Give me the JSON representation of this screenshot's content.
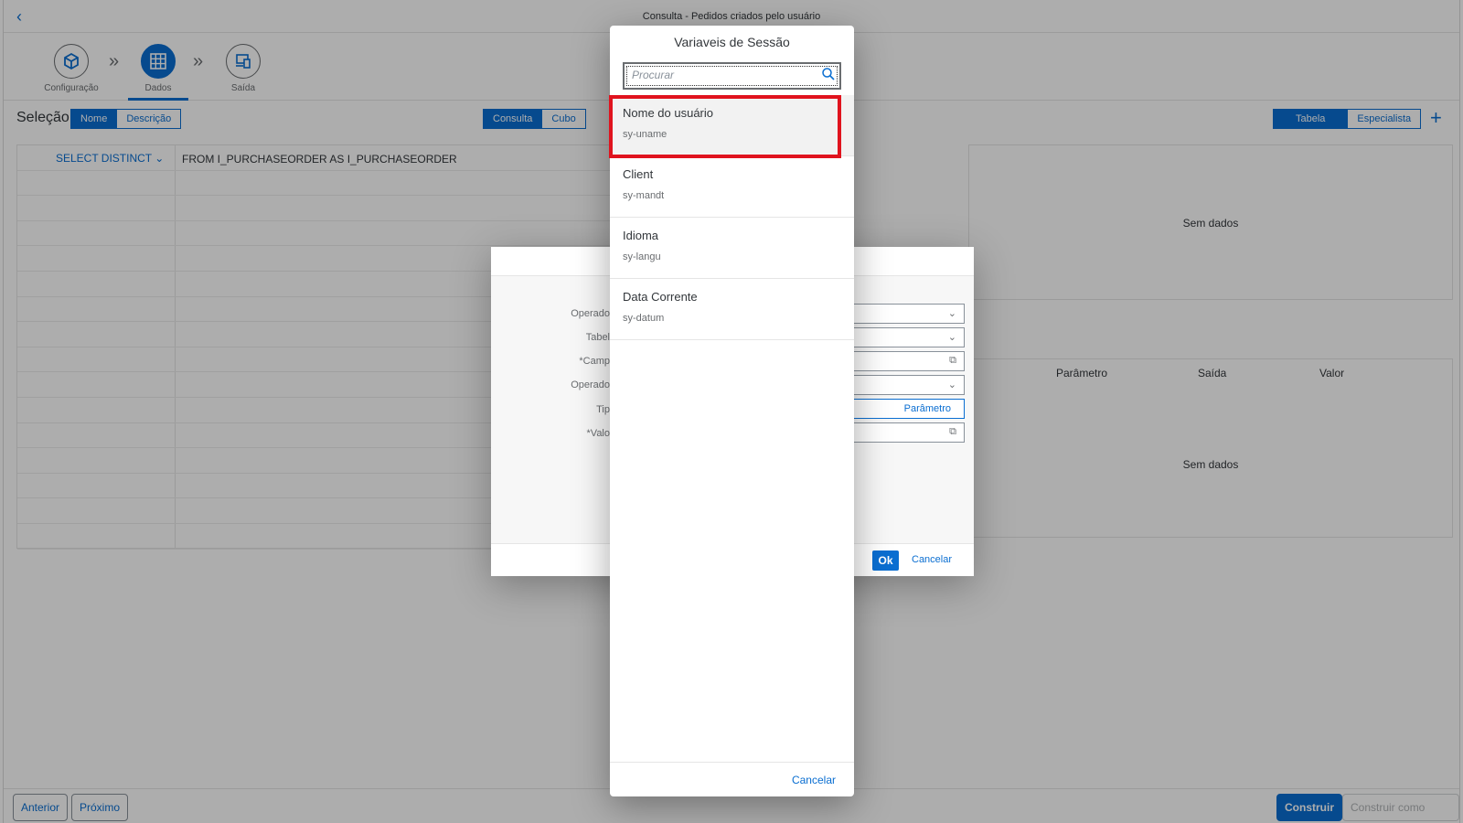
{
  "shell": {
    "title": "Consulta - Pedidos criados pelo usuário"
  },
  "steps": [
    {
      "label": "Configuração",
      "icon": "cube-icon"
    },
    {
      "label": "Dados",
      "icon": "grid-icon"
    },
    {
      "label": "Saída",
      "icon": "devices-icon"
    }
  ],
  "selection": {
    "label": "Seleção",
    "toggle": [
      "Nome",
      "Descrição"
    ],
    "mode": [
      "Consulta",
      "Cubo"
    ],
    "view": [
      "Tabela",
      "Especialista"
    ]
  },
  "query": {
    "select": "SELECT DISTINCT",
    "from": "FROM I_PURCHASEORDER AS I_PURCHASEORDER"
  },
  "right_panel": {
    "no_data_top": "Sem dados",
    "columns": [
      "Parâmetro",
      "Saída",
      "Valor"
    ],
    "no_data_bottom": "Sem dados"
  },
  "filter_dialog": {
    "labels": [
      "Operado",
      "Tabel",
      "*Camp",
      "Operado",
      "Tip",
      "*Valo"
    ],
    "tipo_button": "Parâmetro",
    "ok": "Ok",
    "cancel": "Cancelar"
  },
  "footer": {
    "prev": "Anterior",
    "next": "Próximo",
    "build": "Construir",
    "build_new": "Construir como novo"
  },
  "popup": {
    "title": "Variaveis de Sessão",
    "search_placeholder": "Procurar",
    "items": [
      {
        "title": "Nome do usuário",
        "desc": "sy-uname"
      },
      {
        "title": "Client",
        "desc": "sy-mandt"
      },
      {
        "title": "Idioma",
        "desc": "sy-langu"
      },
      {
        "title": "Data Corrente",
        "desc": "sy-datum"
      }
    ],
    "cancel": "Cancelar"
  },
  "colors": {
    "accent": "#0a6ed1",
    "highlight": "#e0131e"
  }
}
